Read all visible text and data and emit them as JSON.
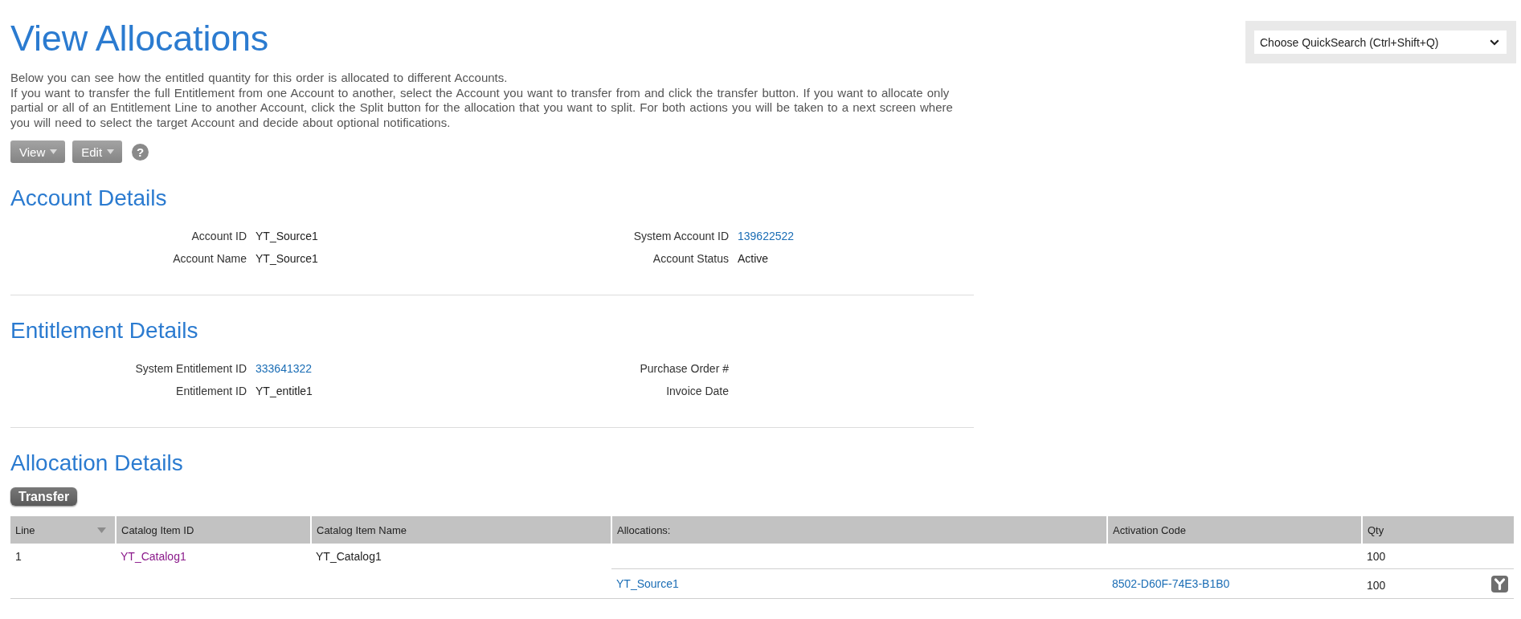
{
  "title": "View Allocations",
  "intro": [
    "Below you can see how the entitled quantity for this order is allocated to different Accounts.",
    "If you want to transfer the full Entitlement from one Account to another, select the Account you want to transfer from and click the transfer button. If you want to allocate only partial or all of an Entitlement Line to another Account, click the Split button for the allocation that you want to split. For both actions you will be taken to a next screen where you will need to select the target Account and decide about optional notifications."
  ],
  "toolbar": {
    "menus": [
      {
        "label": "View",
        "kind": "menu"
      },
      {
        "label": "Edit",
        "kind": "menu"
      }
    ],
    "help": "?"
  },
  "quick_search": {
    "value": "Choose QuickSearch (Ctrl+Shift+Q)"
  },
  "sections": [
    {
      "title": "Account Details",
      "fields": [
        {
          "label": "Account ID",
          "value": "YT_Source1",
          "link": false
        },
        {
          "label": "System Account ID",
          "value": "139622522",
          "link": true
        },
        {
          "label": "Account Name",
          "value": "YT_Source1",
          "link": false
        },
        {
          "label": "Account Status",
          "value": "Active",
          "link": false
        }
      ]
    },
    {
      "title": "Entitlement Details",
      "fields": [
        {
          "label": "System Entitlement ID",
          "value": "333641322",
          "link": true
        },
        {
          "label": "Purchase Order #"
        },
        {
          "label": "Entitlement ID",
          "value": "YT_entitle1",
          "link": false
        },
        {
          "label": "Invoice Date"
        }
      ]
    }
  ],
  "allocation_details": {
    "title": "Allocation Details",
    "transfer_button": "Transfer",
    "table": {
      "columns": [
        {
          "label": "Line",
          "sortable": true
        },
        {
          "label": "Catalog Item ID",
          "sortable": false
        },
        {
          "label": "Catalog Item Name",
          "sortable": false
        },
        {
          "label": "Allocations:",
          "sortable": false
        },
        {
          "label": "Activation Code",
          "sortable": false
        },
        {
          "label": "Qty",
          "sortable": false
        }
      ],
      "rows": [
        {
          "line": "1",
          "catalog_item_id": {
            "text": "YT_Catalog1",
            "visited": true
          },
          "catalog_item_name": "YT_Catalog1",
          "qty": "100",
          "allocations": [
            {
              "account": "YT_Source1",
              "activation_code": "8502-D60F-74E3-B1B0",
              "qty": "100"
            }
          ]
        }
      ]
    }
  }
}
